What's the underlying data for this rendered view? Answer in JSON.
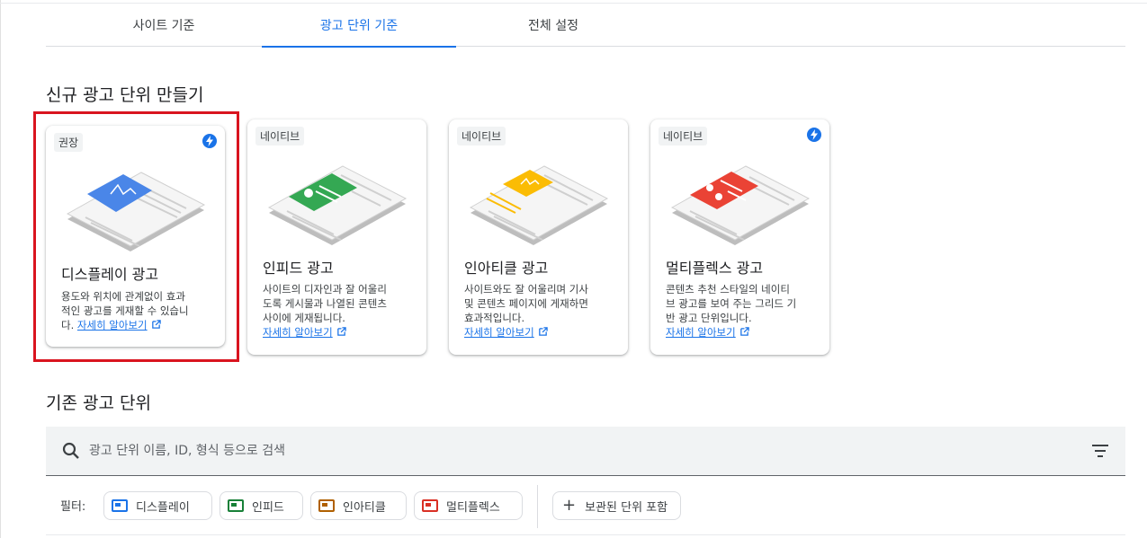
{
  "tabs": [
    {
      "label": "사이트 기준",
      "active": false
    },
    {
      "label": "광고 단위 기준",
      "active": true
    },
    {
      "label": "전체 설정",
      "active": false
    }
  ],
  "new_section": {
    "title": "신규 광고 단위 만들기"
  },
  "cards": [
    {
      "chip": "권장",
      "title": "디스플레이 광고",
      "desc_lines": [
        "용도와 위치에 관계없이 효과",
        "적인 광고를 게재할 수 있습니",
        "다."
      ],
      "learn_more": "자세히 알아보기",
      "accent": "#4a86e8",
      "has_bolt": true
    },
    {
      "chip": "네이티브",
      "title": "인피드 광고",
      "desc_lines": [
        "사이트의 디자인과 잘 어울리",
        "도록 게시물과 나열된 콘텐츠",
        "사이에 게재됩니다."
      ],
      "learn_more": "자세히 알아보기",
      "accent": "#34a853",
      "has_bolt": false
    },
    {
      "chip": "네이티브",
      "title": "인아티클 광고",
      "desc_lines": [
        "사이트와도 잘 어울리며 기사",
        "및 콘텐츠 페이지에 게재하면",
        "효과적입니다."
      ],
      "learn_more": "자세히 알아보기",
      "accent": "#fbbc04",
      "has_bolt": false
    },
    {
      "chip": "네이티브",
      "title": "멀티플렉스 광고",
      "desc_lines": [
        "콘텐츠 추천 스타일의 네이티",
        "브 광고를 보여 주는 그리드 기",
        "반 광고 단위입니다."
      ],
      "learn_more": "자세히 알아보기",
      "accent": "#ea4335",
      "has_bolt": true
    }
  ],
  "existing_section": {
    "title": "기존 광고 단위"
  },
  "search": {
    "placeholder": "광고 단위 이름, ID, 형식 등으로 검색"
  },
  "filter": {
    "label": "필터:",
    "chips": [
      {
        "label": "디스플레이",
        "color": "#1a73e8"
      },
      {
        "label": "인피드",
        "color": "#188038"
      },
      {
        "label": "인아티클",
        "color": "#b06000"
      },
      {
        "label": "멀티플렉스",
        "color": "#d93025"
      }
    ],
    "archived_label": "보관된 단위 포함"
  },
  "colors": {
    "accent": "#1a73e8",
    "highlight": "#d9141f"
  }
}
